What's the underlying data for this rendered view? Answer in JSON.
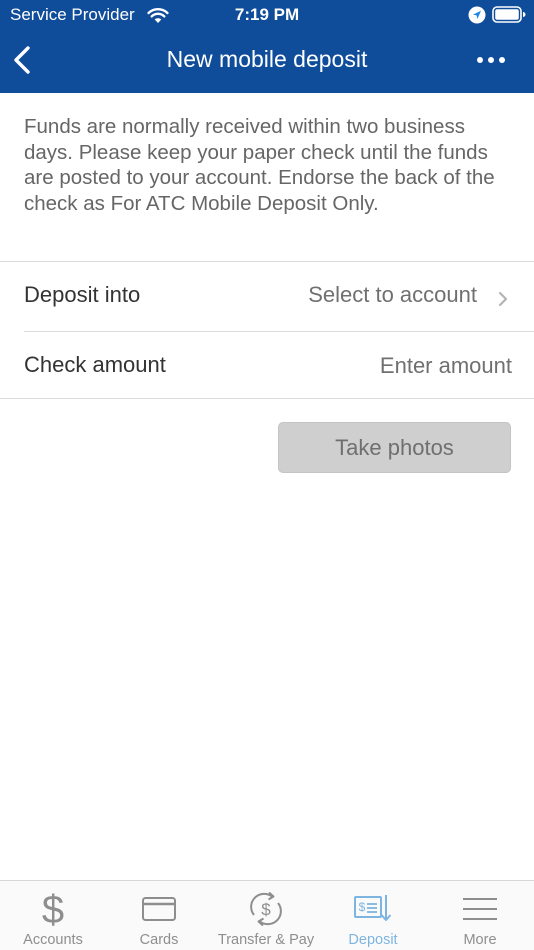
{
  "status_bar": {
    "carrier": "Service Provider",
    "time": "7:19 PM"
  },
  "nav": {
    "title": "New mobile deposit"
  },
  "intro_text": "Funds are normally received within two business days. Please keep your paper check until the funds are posted to your account. Endorse the back of the check as For ATC Mobile Deposit Only.",
  "form": {
    "deposit_into": {
      "label": "Deposit into",
      "value": "Select to account"
    },
    "check_amount": {
      "label": "Check amount",
      "value": "",
      "placeholder": "Enter amount"
    }
  },
  "take_photos_label": "Take photos",
  "tabs": [
    {
      "label": "Accounts",
      "icon": "dollar-icon"
    },
    {
      "label": "Cards",
      "icon": "card-icon"
    },
    {
      "label": "Transfer & Pay",
      "icon": "transfer-icon"
    },
    {
      "label": "Deposit",
      "icon": "deposit-check-icon",
      "active": true
    },
    {
      "label": "More",
      "icon": "menu-icon"
    }
  ],
  "colors": {
    "header_bg": "#0f4c9a",
    "active_tab": "#7eb5e0",
    "inactive_tab": "#8e8e8e",
    "button_bg": "#cfcfcf"
  }
}
